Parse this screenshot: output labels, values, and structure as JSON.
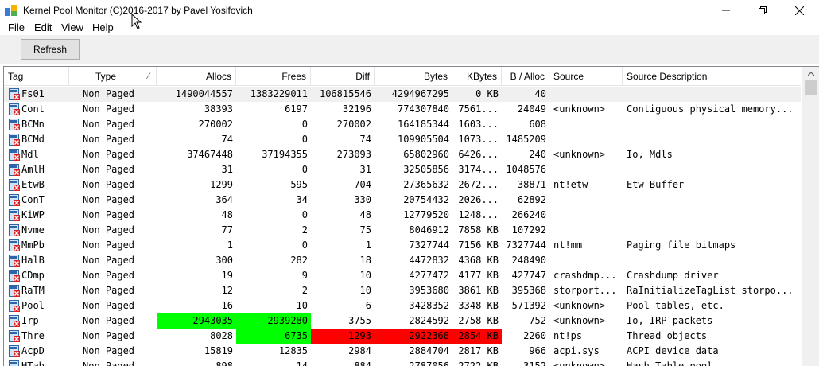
{
  "window": {
    "title": "Kernel Pool Monitor (C)2016-2017 by Pavel Yosifovich"
  },
  "menu": [
    "File",
    "Edit",
    "View",
    "Help"
  ],
  "toolbar": {
    "refresh_label": "Refresh"
  },
  "columns": {
    "tag": "Tag",
    "type": "Type",
    "allocs": "Allocs",
    "frees": "Frees",
    "diff": "Diff",
    "bytes": "Bytes",
    "kbytes": "KBytes",
    "balloc": "B / Alloc",
    "source": "Source",
    "srcdesc": "Source Description"
  },
  "colors": {
    "green": "#00ff00",
    "red": "#ff0000",
    "selected": "#f0f0f0"
  },
  "rows": [
    {
      "tag": "Fs01",
      "type": "Non Paged",
      "allocs": "1490044557",
      "frees": "1383229011",
      "diff": "106815546",
      "bytes": "4294967295",
      "kbytes": "0 KB",
      "balloc": "40",
      "source": "",
      "desc": ""
    },
    {
      "tag": "Cont",
      "type": "Non Paged",
      "allocs": "38393",
      "frees": "6197",
      "diff": "32196",
      "bytes": "774307840",
      "kbytes": "7561...",
      "balloc": "24049",
      "source": "<unknown>",
      "desc": "Contiguous physical memory..."
    },
    {
      "tag": "BCMn",
      "type": "Non Paged",
      "allocs": "270002",
      "frees": "0",
      "diff": "270002",
      "bytes": "164185344",
      "kbytes": "1603...",
      "balloc": "608",
      "source": "",
      "desc": ""
    },
    {
      "tag": "BCMd",
      "type": "Non Paged",
      "allocs": "74",
      "frees": "0",
      "diff": "74",
      "bytes": "109905504",
      "kbytes": "1073...",
      "balloc": "1485209",
      "source": "",
      "desc": ""
    },
    {
      "tag": "Mdl",
      "type": "Non Paged",
      "allocs": "37467448",
      "frees": "37194355",
      "diff": "273093",
      "bytes": "65802960",
      "kbytes": "6426...",
      "balloc": "240",
      "source": "<unknown>",
      "desc": "Io, Mdls"
    },
    {
      "tag": "AmlH",
      "type": "Non Paged",
      "allocs": "31",
      "frees": "0",
      "diff": "31",
      "bytes": "32505856",
      "kbytes": "3174...",
      "balloc": "1048576",
      "source": "",
      "desc": ""
    },
    {
      "tag": "EtwB",
      "type": "Non Paged",
      "allocs": "1299",
      "frees": "595",
      "diff": "704",
      "bytes": "27365632",
      "kbytes": "2672...",
      "balloc": "38871",
      "source": "nt!etw",
      "desc": "Etw Buffer"
    },
    {
      "tag": "ConT",
      "type": "Non Paged",
      "allocs": "364",
      "frees": "34",
      "diff": "330",
      "bytes": "20754432",
      "kbytes": "2026...",
      "balloc": "62892",
      "source": "",
      "desc": ""
    },
    {
      "tag": "KiWP",
      "type": "Non Paged",
      "allocs": "48",
      "frees": "0",
      "diff": "48",
      "bytes": "12779520",
      "kbytes": "1248...",
      "balloc": "266240",
      "source": "",
      "desc": ""
    },
    {
      "tag": "Nvme",
      "type": "Non Paged",
      "allocs": "77",
      "frees": "2",
      "diff": "75",
      "bytes": "8046912",
      "kbytes": "7858 KB",
      "balloc": "107292",
      "source": "",
      "desc": ""
    },
    {
      "tag": "MmPb",
      "type": "Non Paged",
      "allocs": "1",
      "frees": "0",
      "diff": "1",
      "bytes": "7327744",
      "kbytes": "7156 KB",
      "balloc": "7327744",
      "source": "nt!mm",
      "desc": "Paging file bitmaps"
    },
    {
      "tag": "HalB",
      "type": "Non Paged",
      "allocs": "300",
      "frees": "282",
      "diff": "18",
      "bytes": "4472832",
      "kbytes": "4368 KB",
      "balloc": "248490",
      "source": "",
      "desc": ""
    },
    {
      "tag": "CDmp",
      "type": "Non Paged",
      "allocs": "19",
      "frees": "9",
      "diff": "10",
      "bytes": "4277472",
      "kbytes": "4177 KB",
      "balloc": "427747",
      "source": "crashdmp...",
      "desc": "Crashdump driver"
    },
    {
      "tag": "RaTM",
      "type": "Non Paged",
      "allocs": "12",
      "frees": "2",
      "diff": "10",
      "bytes": "3953680",
      "kbytes": "3861 KB",
      "balloc": "395368",
      "source": "storport...",
      "desc": "RaInitializeTagList storpo..."
    },
    {
      "tag": "Pool",
      "type": "Non Paged",
      "allocs": "16",
      "frees": "10",
      "diff": "6",
      "bytes": "3428352",
      "kbytes": "3348 KB",
      "balloc": "571392",
      "source": "<unknown>",
      "desc": "Pool tables, etc."
    },
    {
      "tag": "Irp",
      "type": "Non Paged",
      "allocs": "2943035",
      "frees": "2939280",
      "diff": "3755",
      "bytes": "2824592",
      "kbytes": "2758 KB",
      "balloc": "752",
      "source": "<unknown>",
      "desc": "Io, IRP packets",
      "hl": {
        "allocs": "green",
        "frees": "green"
      }
    },
    {
      "tag": "Thre",
      "type": "Non Paged",
      "allocs": "8028",
      "frees": "6735",
      "diff": "1293",
      "bytes": "2922368",
      "kbytes": "2854 KB",
      "balloc": "2260",
      "source": "nt!ps",
      "desc": "Thread objects",
      "hl": {
        "frees": "green",
        "diff": "red",
        "bytes": "red",
        "kbytes": "red"
      }
    },
    {
      "tag": "AcpD",
      "type": "Non Paged",
      "allocs": "15819",
      "frees": "12835",
      "diff": "2984",
      "bytes": "2884704",
      "kbytes": "2817 KB",
      "balloc": "966",
      "source": "acpi.sys",
      "desc": "ACPI device data"
    },
    {
      "tag": "HTab",
      "type": "Non Paged",
      "allocs": "898",
      "frees": "14",
      "diff": "884",
      "bytes": "2787056",
      "kbytes": "2722 KB",
      "balloc": "3152",
      "source": "<unknown>",
      "desc": "Hash Table pool"
    }
  ]
}
